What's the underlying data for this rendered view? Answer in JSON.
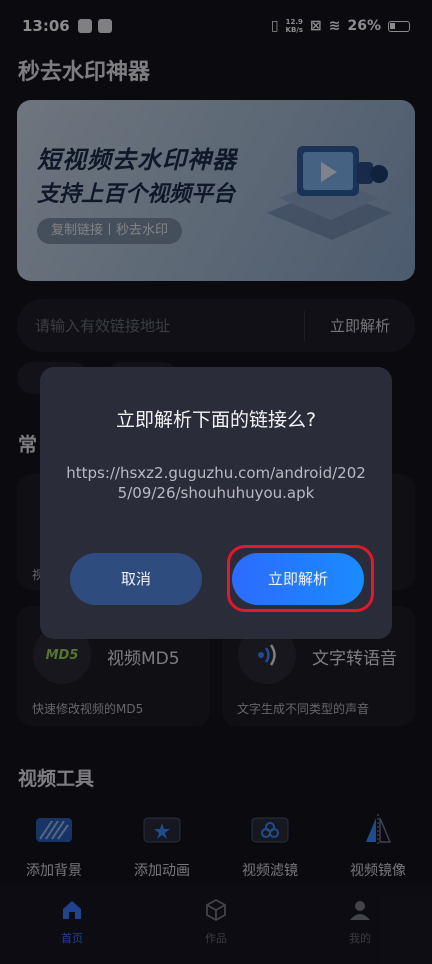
{
  "status": {
    "time": "13:06",
    "speed_top": "12.9",
    "speed_bottom": "KB/s",
    "battery": "26%"
  },
  "app": {
    "title": "秒去水印神器"
  },
  "banner": {
    "line1": "短视频去水印神器",
    "line2": "支持上百个视频平台",
    "pill": "复制链接丨秒去水印"
  },
  "url_bar": {
    "placeholder": "请输入有效链接地址",
    "parse_label": "立即解析"
  },
  "common": {
    "title_partial": "常"
  },
  "cards": [
    {
      "icon_text": "MD5",
      "name": "视频MD5",
      "desc": "快速修改视频的MD5"
    },
    {
      "name": "文字转语音",
      "desc": "文字生成不同类型的声音"
    }
  ],
  "card_partial_label": "视",
  "video_tools": {
    "title": "视频工具",
    "items": [
      {
        "label": "添加背景",
        "icon": "background-icon"
      },
      {
        "label": "添加动画",
        "icon": "animation-icon"
      },
      {
        "label": "视频滤镜",
        "icon": "filter-icon"
      },
      {
        "label": "视频镜像",
        "icon": "mirror-icon"
      }
    ]
  },
  "tabs": [
    {
      "label": "首页",
      "icon": "home-icon",
      "active": true
    },
    {
      "label": "作品",
      "icon": "box-icon",
      "active": false
    },
    {
      "label": "我的",
      "icon": "user-icon",
      "active": false
    }
  ],
  "dialog": {
    "title": "立即解析下面的链接么?",
    "url": "https://hsxz2.guguzhu.com/android/2025/09/26/shouhuhuyou.apk",
    "cancel_label": "取消",
    "confirm_label": "立即解析"
  },
  "colors": {
    "accent": "#2d6bff",
    "highlight": "#e0192b",
    "background": "#13131c"
  }
}
